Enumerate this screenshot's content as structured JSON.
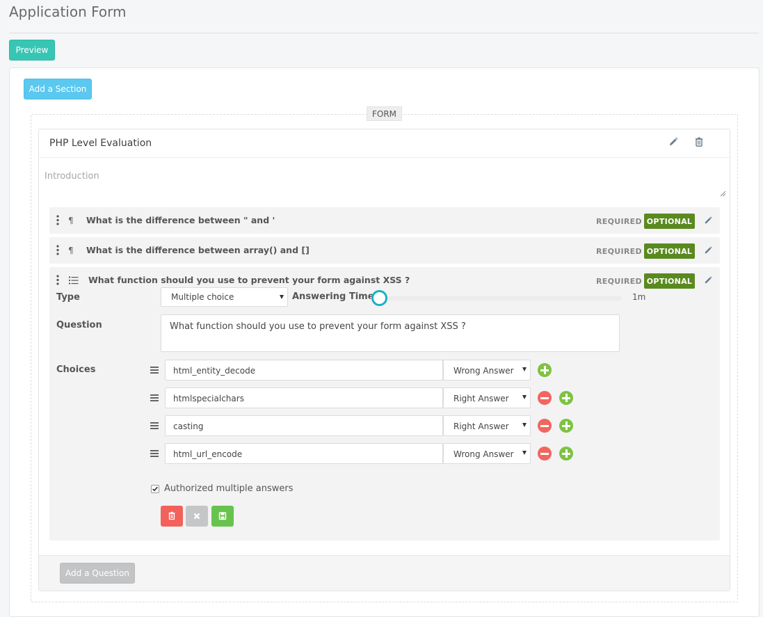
{
  "page": {
    "title": "Application Form"
  },
  "toolbar": {
    "preview_label": "Preview",
    "add_section_label": "Add a Section"
  },
  "form": {
    "legend": "FORM"
  },
  "section": {
    "title": "PHP Level Evaluation",
    "intro_placeholder": "Introduction",
    "add_question_label": "Add a Question",
    "icons": {
      "edit": "pencil-icon",
      "delete": "trash-icon"
    }
  },
  "questions": [
    {
      "type_icon": "paragraph-icon",
      "title": "What is the difference between \" and '",
      "required_label": "REQUIRED",
      "optional_label": "OPTIONAL"
    },
    {
      "type_icon": "paragraph-icon",
      "title": "What is the difference between array() and []",
      "required_label": "REQUIRED",
      "optional_label": "OPTIONAL"
    },
    {
      "type_icon": "list-icon",
      "title": "What function should you use to prevent your form against XSS ?",
      "required_label": "REQUIRED",
      "optional_label": "OPTIONAL",
      "type_label": "Type",
      "type_value": "Multiple choice",
      "answering_time_label": "Answering Time",
      "answering_time_value": "1m",
      "question_label": "Question",
      "question_value": "What function should you use to prevent your form against XSS ?",
      "choices_label": "Choices",
      "choices": [
        {
          "text": "html_entity_decode",
          "answer": "Wrong Answer"
        },
        {
          "text": "htmlspecialchars",
          "answer": "Right Answer"
        },
        {
          "text": "casting",
          "answer": "Right Answer"
        },
        {
          "text": "html_url_encode",
          "answer": "Wrong Answer"
        }
      ],
      "authorized_multiple_label": "Authorized multiple answers",
      "authorized_multiple_checked": true
    }
  ],
  "colors": {
    "preview": "#38c6b4",
    "add_section": "#5bc8ef",
    "optional": "#5a8a1f",
    "slider_knob": "#1ab0c3",
    "remove": "#f26660",
    "add": "#7ec242",
    "delete_action": "#f2615a",
    "save_action": "#67c34d"
  }
}
